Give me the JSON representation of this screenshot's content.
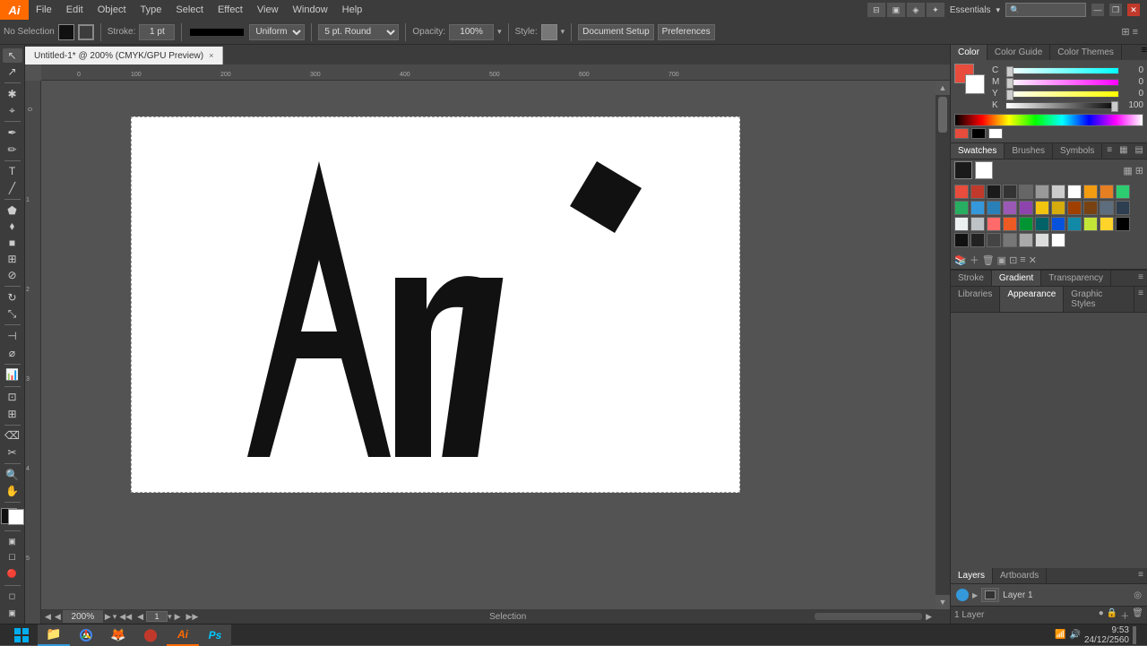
{
  "app": {
    "logo": "Ai",
    "title": "Untitled-1* @ 200% (CMYK/GPU Preview)",
    "tab_close": "×"
  },
  "menu": {
    "items": [
      "File",
      "Edit",
      "Object",
      "Type",
      "Select",
      "Effect",
      "View",
      "Window",
      "Help"
    ],
    "workspace": "Essentials",
    "search_placeholder": ""
  },
  "options_bar": {
    "selection_label": "No Selection",
    "stroke_label": "Stroke:",
    "stroke_weight": "1 pt",
    "stroke_type": "Uniform",
    "stroke_profile": "5 pt. Round",
    "opacity_label": "Opacity:",
    "opacity_value": "100%",
    "style_label": "Style:",
    "doc_setup_btn": "Document Setup",
    "preferences_btn": "Preferences"
  },
  "canvas": {
    "zoom": "200%",
    "zoom_input": "200%",
    "page_num": "1",
    "status_text": "Selection"
  },
  "color_panel": {
    "tabs": [
      "Color",
      "Color Guide",
      "Color Themes"
    ],
    "active_tab": "Color",
    "c_val": "0",
    "m_val": "0",
    "y_val": "0",
    "k_val": "100"
  },
  "swatches_panel": {
    "tabs": [
      "Swatches",
      "Brushes",
      "Symbols"
    ],
    "active_tab": "Swatches"
  },
  "sub_panel": {
    "tabs": [
      "Stroke",
      "Gradient",
      "Transparency"
    ],
    "active_tab": "Gradient"
  },
  "bottom_panel": {
    "tabs": [
      "Libraries",
      "Appearance",
      "Graphic Styles"
    ],
    "active_tab": "Appearance"
  },
  "layers_panel": {
    "tabs": [
      "Layers",
      "Artboards"
    ],
    "active_tab": "Layers",
    "layers": [
      {
        "name": "Layer 1",
        "visible": true,
        "locked": false
      }
    ],
    "layer_count": "1 Layer"
  },
  "swatches": {
    "colors": [
      "#e74c3c",
      "#c0392b",
      "#1a1a1a",
      "#333",
      "#666",
      "#999",
      "#ccc",
      "#fff",
      "#f39c12",
      "#e67e22",
      "#2ecc71",
      "#27ae60",
      "#3498db",
      "#2980b9",
      "#9b59b6",
      "#8e44ad",
      "#f1c40f",
      "#d4ac0d",
      "#a04000",
      "#784212",
      "#5d6d7e",
      "#2c3e50",
      "#ecf0f1",
      "#bdc3c7",
      "#ff6b6b",
      "#ee5a24",
      "#009432",
      "#006266",
      "#0652dd",
      "#1289a7",
      "#c4e538",
      "#ffd32a",
      "#000",
      "#111",
      "#222",
      "#444",
      "#777",
      "#aaa",
      "#ddd",
      "#fff"
    ]
  },
  "taskbar": {
    "time": "9:53",
    "date": "24/12/2560",
    "apps": [
      "windows",
      "explorer",
      "chrome",
      "firefox",
      "illustrator_task",
      "photoshop_task"
    ]
  }
}
